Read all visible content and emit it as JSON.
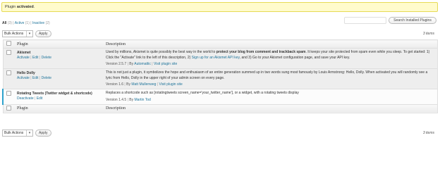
{
  "notice": {
    "pre": "Plugin ",
    "strong": "activated",
    "post": "."
  },
  "filters": {
    "all": "All",
    "all_count": "(3)",
    "sep": "|",
    "active": "Active",
    "active_count": "(1)",
    "inactive": "Inactive",
    "inactive_count": "(2)"
  },
  "search": {
    "placeholder": "",
    "button": "Search Installed Plugins"
  },
  "bulk": {
    "select": "Bulk Actions",
    "apply": "Apply"
  },
  "items_count": "3 items",
  "columns": {
    "plugin": "Plugin",
    "description": "Description"
  },
  "plugins": [
    {
      "name": "Akismet",
      "actions": [
        "Activate",
        "Edit",
        "Delete"
      ],
      "desc_a": "Used by millions, Akismet is quite possibly the best way in the world to ",
      "desc_strong": "protect your blog from comment and trackback spam",
      "desc_b": ". It keeps your site protected from spam even while you sleep. To get started: 1) Click the \"Activate\" link to the left of this description, 2) ",
      "desc_link": "Sign up for an Akismet API key",
      "desc_c": ", and 3) Go to your Akismet configuration page, and save your API key.",
      "version": "Version 2.5.7",
      "by": "By",
      "author": "Automattic",
      "visit": "Visit plugin site"
    },
    {
      "name": "Hello Dolly",
      "actions": [
        "Activate",
        "Edit",
        "Delete"
      ],
      "desc": "This is not just a plugin, it symbolizes the hope and enthusiasm of an entire generation summed up in two words sung most famously by Louis Armstrong: Hello, Dolly. When activated you will randomly see a lyric from Hello, Dolly in the upper right of your admin screen on every page.",
      "version": "Version 1.6",
      "by": "By",
      "author": "Matt Mullenweg",
      "visit": "Visit plugin site"
    },
    {
      "name": "Rotating Tweets (Twitter widget & shortcode)",
      "actions": [
        "Deactivate",
        "Edit"
      ],
      "desc": "Replaces a shortcode such as [rotatingtweets screen_name='your_twitter_name'], or a widget, with a rotating tweets display",
      "version": "Version 1.4.5",
      "by": "By",
      "author": "Martin Tod"
    }
  ],
  "colors": {
    "notice_bg": "#fffbcc",
    "link": "#21759b",
    "inactive_row": "#eeeeee"
  }
}
